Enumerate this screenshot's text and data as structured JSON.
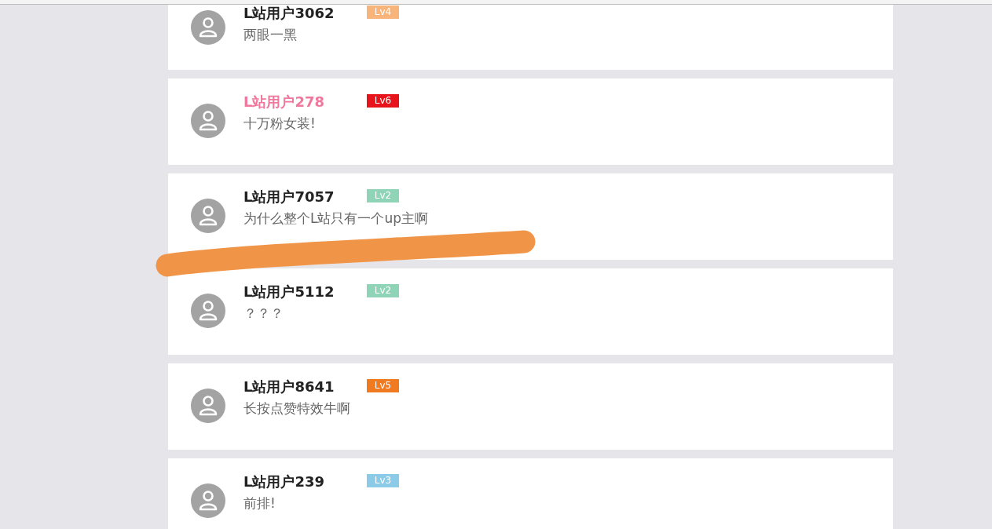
{
  "comments": [
    {
      "user": "L站用户3062",
      "vip": false,
      "badge": {
        "label": "Lv4",
        "color": "#f7b57c"
      },
      "text": "两眼一黑"
    },
    {
      "user": "L站用户278",
      "vip": true,
      "badge": {
        "label": "Lv6",
        "color": "#e8141c"
      },
      "text": "十万粉女装!"
    },
    {
      "user": "L站用户7057",
      "vip": false,
      "badge": {
        "label": "Lv2",
        "color": "#8fd4b7"
      },
      "text": "为什么整个L站只有一个up主啊"
    },
    {
      "user": "L站用户5112",
      "vip": false,
      "badge": {
        "label": "Lv2",
        "color": "#8fd4b7"
      },
      "text": "？？？"
    },
    {
      "user": "L站用户8641",
      "vip": false,
      "badge": {
        "label": "Lv5",
        "color": "#f07a20"
      },
      "text": "长按点赞特效牛啊"
    },
    {
      "user": "L站用户239",
      "vip": false,
      "badge": {
        "label": "Lv3",
        "color": "#8ccbe8"
      },
      "text": "前排!"
    }
  ]
}
